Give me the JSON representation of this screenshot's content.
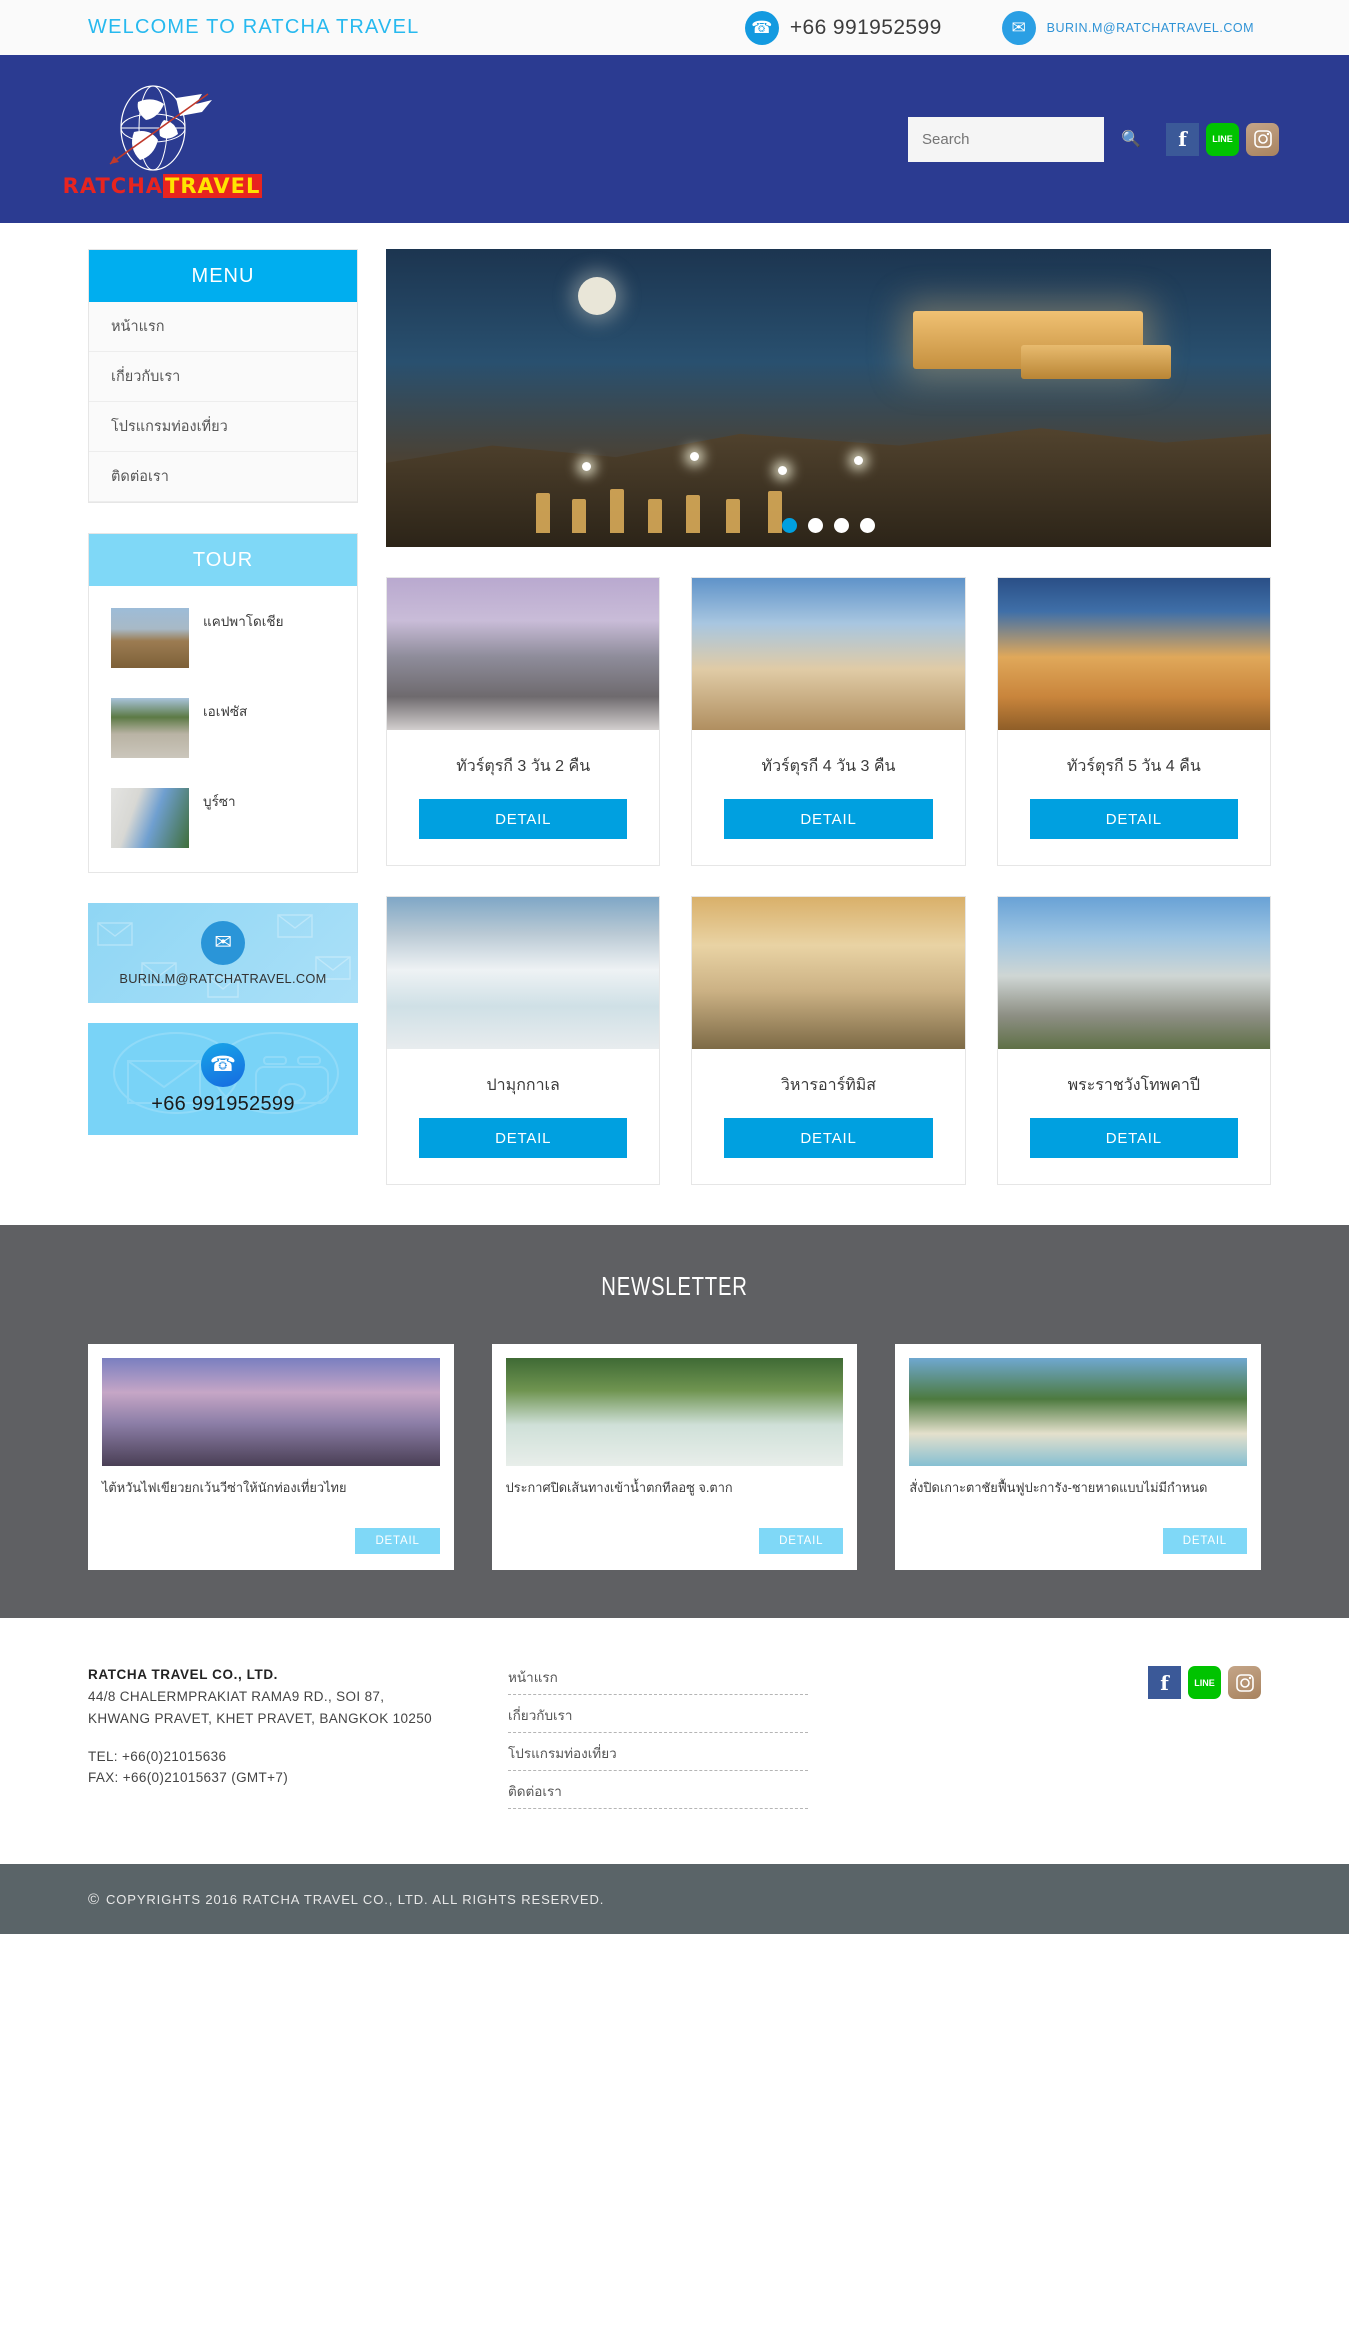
{
  "topbar": {
    "welcome": "WELCOME TO RATCHA TRAVEL",
    "phone_icon": "phone-icon",
    "phone": "+66  991952599",
    "mail_icon": "mail-icon",
    "email": "BURIN.M@RATCHATRAVEL.COM"
  },
  "header": {
    "logo_primary": "RATCHA",
    "logo_secondary": "TRAVEL",
    "search_placeholder": "Search",
    "search_value": "",
    "search_icon": "search-icon",
    "social": [
      {
        "name": "facebook",
        "glyph": "f"
      },
      {
        "name": "line",
        "glyph": "LINE"
      },
      {
        "name": "instagram",
        "glyph": ""
      }
    ]
  },
  "sidebar": {
    "menu_title": "MENU",
    "menu_items": [
      {
        "label": "หน้าแรก"
      },
      {
        "label": "เกี่ยวกับเรา"
      },
      {
        "label": "โปรแกรมท่องเที่ยว"
      },
      {
        "label": "ติดต่อเรา"
      }
    ],
    "tour_title": "TOUR",
    "tour_items": [
      {
        "label": "แคปพาโดเชีย"
      },
      {
        "label": "เอเฟซัส"
      },
      {
        "label": "บูร์ซา"
      }
    ],
    "contact_email": "BURIN.M@RATCHATRAVEL.COM",
    "contact_phone": "+66  991952599"
  },
  "slider": {
    "dots": [
      {
        "active": true
      },
      {
        "active": false
      },
      {
        "active": false
      },
      {
        "active": false
      }
    ]
  },
  "tours_row1": [
    {
      "title": "ทัวร์ตุรกี 3 วัน 2 คืน",
      "button": "DETAIL"
    },
    {
      "title": "ทัวร์ตุรกี 4 วัน 3 คืน",
      "button": "DETAIL"
    },
    {
      "title": "ทัวร์ตุรกี 5 วัน 4 คืน",
      "button": "DETAIL"
    }
  ],
  "tours_row2": [
    {
      "title": "ปามุกกาเล",
      "button": "DETAIL"
    },
    {
      "title": "วิหารอาร์ทิมิส",
      "button": "DETAIL"
    },
    {
      "title": "พระราชวังโทพคาปี",
      "button": "DETAIL"
    }
  ],
  "newsletter": {
    "title": "NEWSLETTER",
    "cards": [
      {
        "text": "ไต้หวันไฟเขียวยกเว้นวีซ่าให้นักท่องเที่ยวไทย",
        "button": "DETAIL"
      },
      {
        "text": "ประกาศปิดเส้นทางเข้าน้ำตกทีลอซู จ.ตาก",
        "button": "DETAIL"
      },
      {
        "text": "สั่งปิดเกาะตาชัยฟื้นฟูปะการัง-ชายหาดแบบไม่มีกำหนด",
        "button": "DETAIL"
      }
    ]
  },
  "footer": {
    "company": "RATCHA TRAVEL CO., LTD.",
    "address_line1": "44/8 CHALERMPRAKIAT RAMA9 RD., SOI 87,",
    "address_line2": "KHWANG PRAVET, KHET PRAVET, BANGKOK 10250",
    "tel": "TEL: +66(0)21015636",
    "fax": "FAX: +66(0)21015637 (GMT+7)",
    "nav": [
      {
        "label": "หน้าแรก"
      },
      {
        "label": "เกี่ยวกับเรา"
      },
      {
        "label": "โปรแกรมท่องเที่ยว"
      },
      {
        "label": "ติดต่อเรา"
      }
    ],
    "social": [
      {
        "name": "facebook",
        "glyph": "f"
      },
      {
        "name": "line",
        "glyph": "LINE"
      },
      {
        "name": "instagram",
        "glyph": ""
      }
    ],
    "copyright": "COPYRIGHTS 2016 RATCHA TRAVEL CO., LTD. ALL RIGHTS RESERVED.",
    "copyright_symbol": "©"
  },
  "colors": {
    "header_blue": "#2b3b91",
    "accent_blue": "#00a0e0",
    "light_blue": "#7fd8f7",
    "gray_section": "#5f6063",
    "copyright_bar": "#5a6468"
  }
}
